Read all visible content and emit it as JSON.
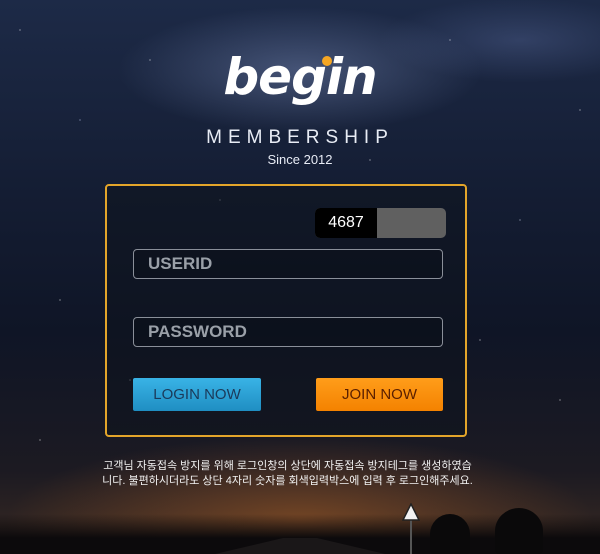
{
  "brand": {
    "logo": "begin",
    "tagline": "MEMBERSHIP",
    "since": "Since 2012"
  },
  "captcha": {
    "code": "4687",
    "input_value": ""
  },
  "form": {
    "userid_placeholder": "USERID",
    "password_placeholder": "PASSWORD"
  },
  "buttons": {
    "login": "LOGIN NOW",
    "join": "JOIN NOW"
  },
  "notice": "고객님 자동접속 방지를 위해 로그인창의 상단에 자동접속 방지테그를 생성하였습니다. 불편하시더라도 상단 4자리 숫자를 회색입력박스에 입력 후 로그인해주세요.",
  "colors": {
    "accent": "#e3a52a",
    "login": "#2aa3d8",
    "join": "#f58c0a"
  }
}
